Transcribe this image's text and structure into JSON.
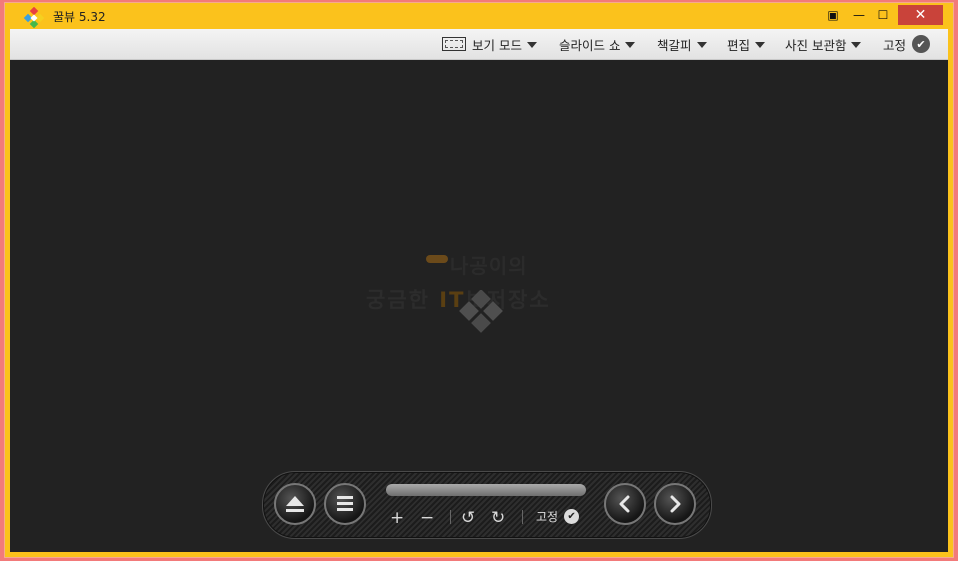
{
  "window": {
    "title": "꿀뷰 5.32",
    "close_glyph": "✕",
    "minimize_glyph": "—",
    "maximize_glyph": "☐",
    "fit_glyph": "▣"
  },
  "menubar": {
    "view_mode": "보기 모드",
    "slideshow": "슬라이드 쇼",
    "bookmark": "책갈피",
    "edit": "편집",
    "photo_storage": "사진 보관함",
    "pin": "고정",
    "pin_check": "✔"
  },
  "watermark": {
    "line1": "나공이의",
    "line2_prefix": "궁금한 ",
    "line2_it": "IT",
    "line2_suffix": "보저장소"
  },
  "controller": {
    "plus": "+",
    "minus": "−",
    "rotate_left": "↺",
    "rotate_right": "↻",
    "pin_label": "고정",
    "pin_check": "✔",
    "progress": 0
  },
  "colors": {
    "titlebar": "#fbc21c",
    "canvas": "#222222",
    "close": "#c9433a"
  }
}
